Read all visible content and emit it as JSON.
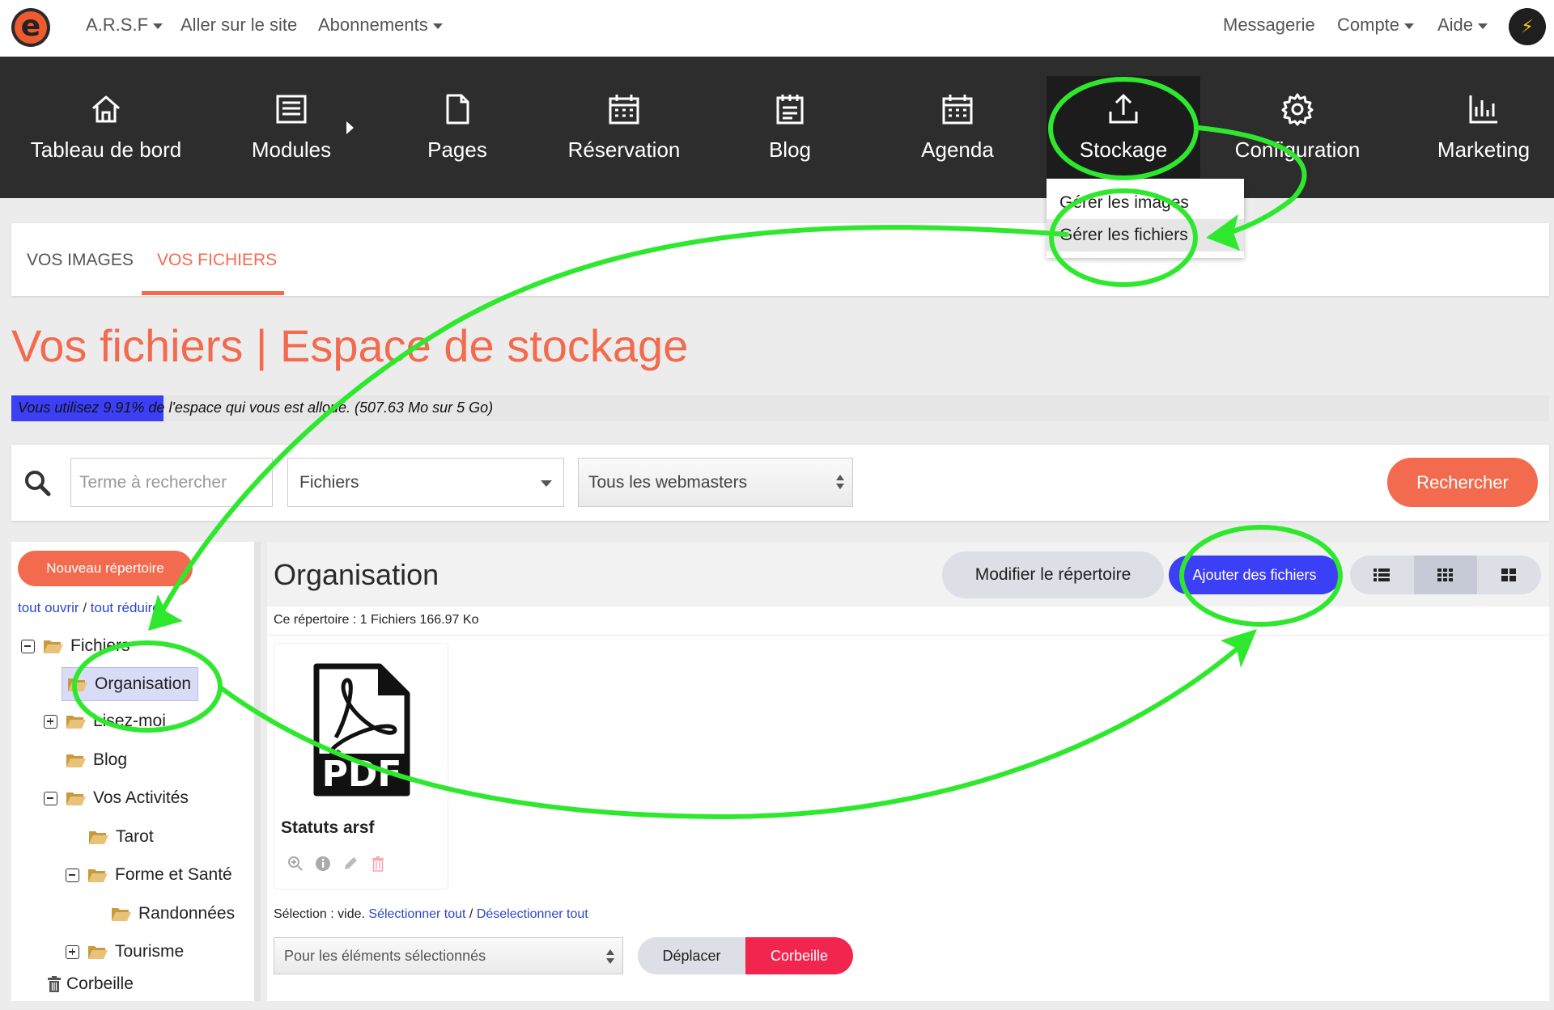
{
  "topbar": {
    "logo_letter": "e",
    "site_menu": "A.R.S.F",
    "visit_site": "Aller sur le site",
    "subscriptions": "Abonnements",
    "messages": "Messagerie",
    "account": "Compte",
    "help": "Aide"
  },
  "nav": {
    "dashboard": "Tableau de bord",
    "modules": "Modules",
    "pages": "Pages",
    "booking": "Réservation",
    "blog": "Blog",
    "agenda": "Agenda",
    "storage": "Stockage",
    "configuration": "Configuration",
    "marketing": "Marketing"
  },
  "storage_dropdown": {
    "manage_images": "Gérer les images",
    "manage_files": "Gérer les fichiers"
  },
  "tabs": {
    "images": "VOS IMAGES",
    "files": "VOS FICHIERS"
  },
  "page_title": "Vos fichiers | Espace de stockage",
  "usage": {
    "percent": 9.91,
    "text": "Vous utilisez 9.91% de l'espace qui vous est alloué. (507.63 Mo sur 5 Go)"
  },
  "search": {
    "placeholder": "Terme à rechercher",
    "type_value": "Fichiers",
    "webmaster_value": "Tous les webmasters",
    "button": "Rechercher"
  },
  "tree": {
    "new_folder_button": "Nouveau répertoire",
    "open_all": "tout ouvrir",
    "separator": " / ",
    "collapse_all": "tout réduire",
    "root": "Fichiers",
    "organisation": "Organisation",
    "lisez_moi": "Lisez-moi",
    "blog": "Blog",
    "activities": "Vos Activités",
    "tarot": "Tarot",
    "health": "Forme et Santé",
    "hikes": "Randonnées",
    "tourism": "Tourisme",
    "trash": "Corbeille"
  },
  "content": {
    "folder_title": "Organisation",
    "edit_folder_button": "Modifier le répertoire",
    "add_files_button": "Ajouter des fichiers",
    "folder_info": "Ce répertoire : 1 Fichiers 166.97 Ko",
    "file_name": "Statuts arsf",
    "pdf_label": "PDF",
    "selection_prefix": "Sélection : vide. ",
    "select_all": "Sélectionner tout",
    "selection_sep": " / ",
    "deselect_all": "Déselectionner tout",
    "bulk_placeholder": "Pour les éléments sélectionnés",
    "move_button": "Déplacer",
    "trash_button": "Corbeille"
  },
  "colors": {
    "accent": "#f26b4f",
    "primary_blue": "#3b3ff5",
    "nav_bg": "#2d2d2d",
    "annotation_green": "#2ee82e",
    "danger": "#f2254e"
  }
}
